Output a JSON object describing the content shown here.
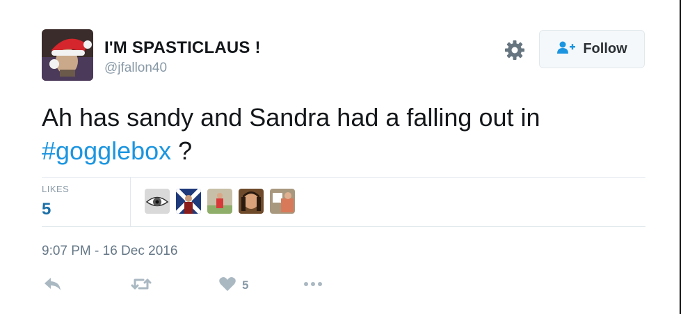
{
  "user": {
    "display_name": "I'M SPASTICLAUS !",
    "handle": "@jfallon40"
  },
  "header": {
    "follow_label": "Follow"
  },
  "tweet": {
    "text": "Ah has sandy and Sandra had a falling out in ",
    "hashtag": "#gogglebox",
    "text_after": " ?"
  },
  "stats": {
    "likes_label": "LIKES",
    "likes_count": "5",
    "liker_avatars": [
      "eye-avatar",
      "flag-avatar",
      "figure-avatar",
      "face-avatar",
      "photo-avatar"
    ]
  },
  "meta": {
    "timestamp": "9:07 PM - 16 Dec 2016"
  },
  "actions": {
    "like_count": "5"
  },
  "colors": {
    "link": "#1b95e0",
    "likes_number": "#1b6fa8",
    "muted": "#8899a6",
    "icon": "#aab8c2"
  }
}
